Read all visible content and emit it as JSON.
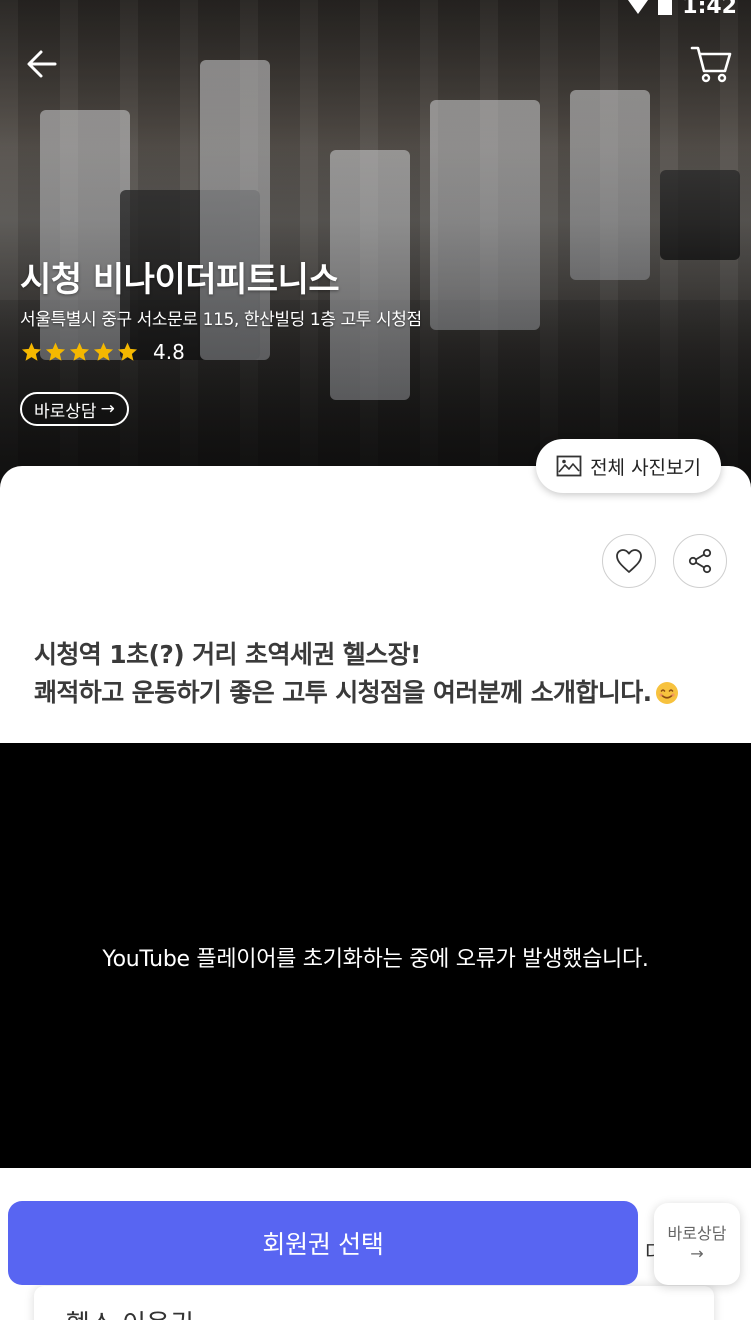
{
  "status_bar": {
    "time": "1:42"
  },
  "header": {
    "back_icon": "arrow-left-icon",
    "cart_icon": "cart-icon"
  },
  "gym": {
    "name": "시청 비나이더피트니스",
    "address": "서울특별시 중구 서소문로 115, 한산빌딩 1층 고투 시청점",
    "rating": "4.8",
    "stars": 5,
    "consult_chip": "바로상담",
    "consult_arrow": "→"
  },
  "gallery": {
    "view_all_label": "전체 사진보기",
    "icon": "image-icon"
  },
  "actions": {
    "like_icon": "heart-icon",
    "share_icon": "share-icon"
  },
  "intro": {
    "line1": "시청역 1초(?) 거리 초역세권 헬스장!",
    "line2": "쾌적하고 운동하기 좋은 고투 시청점을 여러분께 소개합니다."
  },
  "video": {
    "error_text": "YouTube 플레이어를 초기화하는 중에 오류가 발생했습니다."
  },
  "bottom": {
    "select_membership_label": "회원권 선택",
    "peek_label": "더",
    "float_consult_label": "바로상담",
    "float_consult_arrow": "→",
    "membership_card_title": "헬스 이용권"
  },
  "colors": {
    "primary": "#5865f2",
    "star": "#f5b800",
    "video_bg": "#000000"
  }
}
